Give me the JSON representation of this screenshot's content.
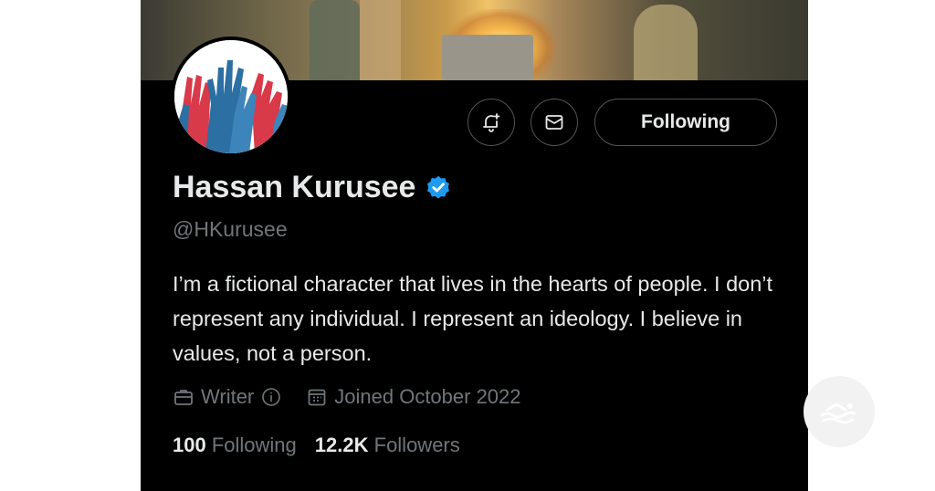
{
  "profile": {
    "name": "Hassan Kurusee",
    "handle": "@HKurusee",
    "bio": "I’m a fictional character that lives in the hearts of people. I don’t represent any individual. I represent an ideology. I believe in values, not a person.",
    "category": "Writer",
    "joined": "Joined October 2022",
    "following_count": "100",
    "following_label": "Following",
    "followers_count": "12.2K",
    "followers_label": "Followers",
    "verified": true
  },
  "actions": {
    "follow_button_label": "Following",
    "notify_icon": "bell-plus-icon",
    "message_icon": "envelope-icon"
  },
  "colors": {
    "background": "#000000",
    "text_primary": "#e7e9ea",
    "text_secondary": "#71767b",
    "verified_blue": "#1d9bf0",
    "button_border": "#555555"
  },
  "icons": {
    "category": "briefcase-icon",
    "joined": "calendar-icon",
    "info": "info-circle-icon",
    "verified": "verified-badge-icon"
  }
}
